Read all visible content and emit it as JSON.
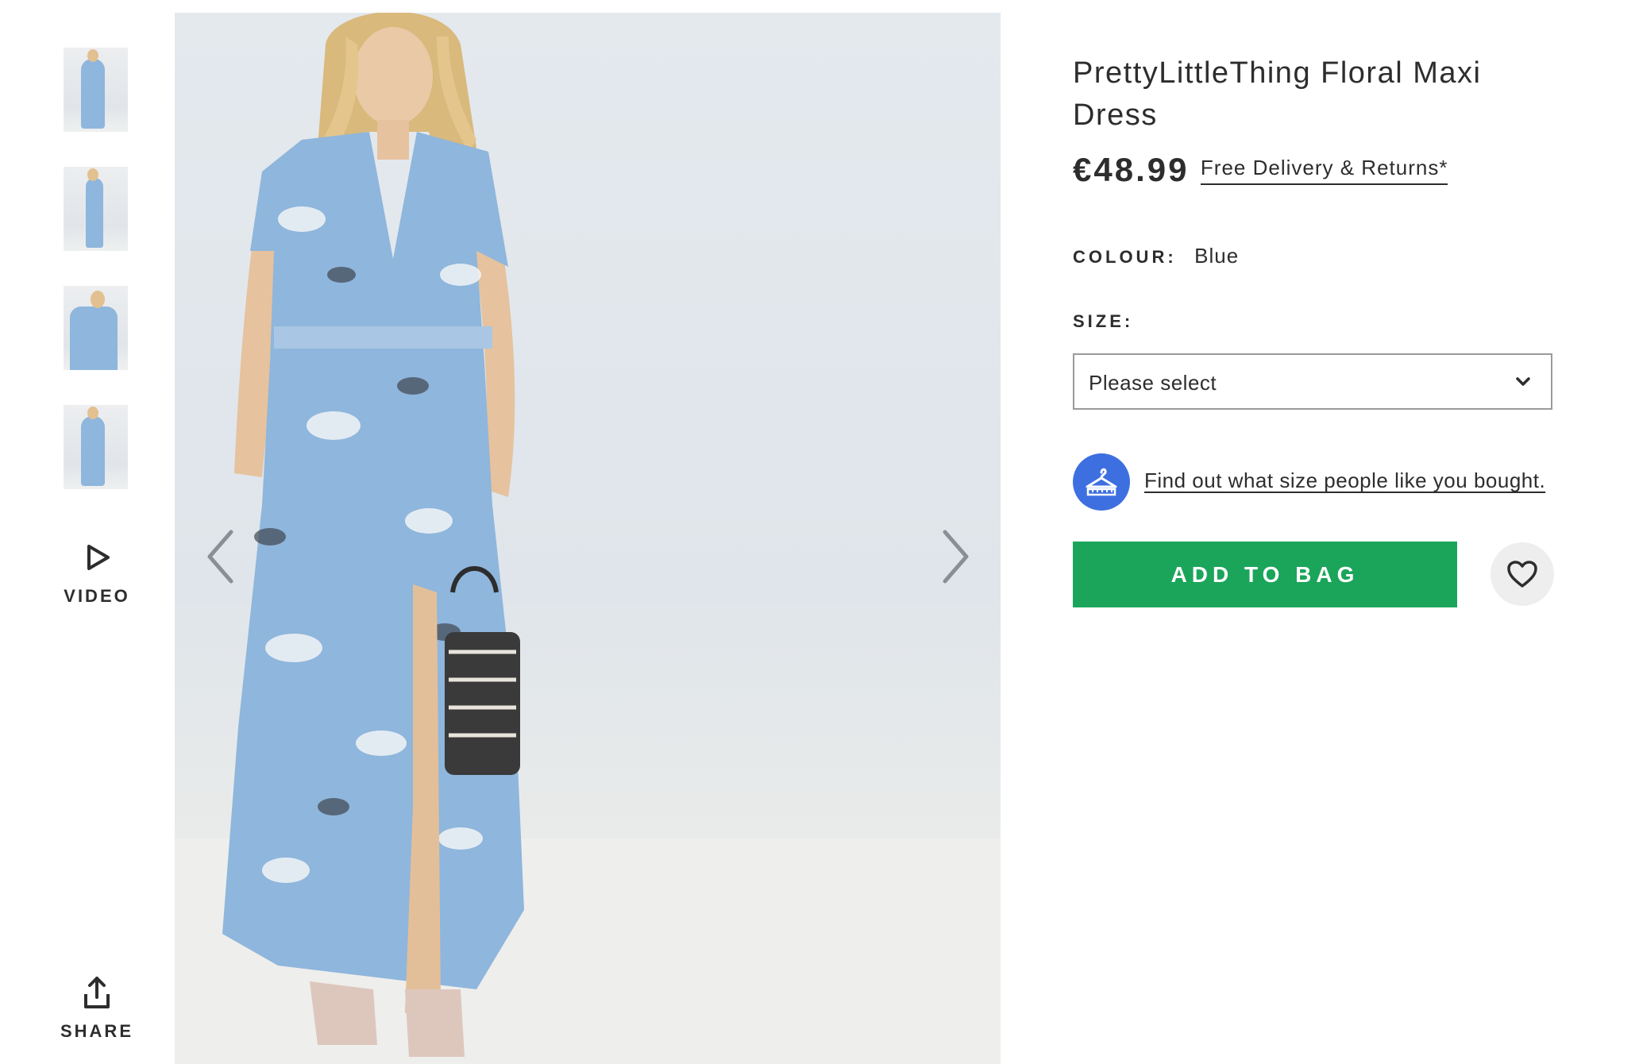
{
  "gallery": {
    "thumbnails": [
      {
        "alt": "thumbnail-1"
      },
      {
        "alt": "thumbnail-2"
      },
      {
        "alt": "thumbnail-3"
      },
      {
        "alt": "thumbnail-4"
      }
    ],
    "video_label": "VIDEO",
    "share_label": "SHARE",
    "icons": {
      "play": "play-icon",
      "share": "share-icon",
      "prev": "chevron-left-icon",
      "next": "chevron-right-icon"
    }
  },
  "product": {
    "title": "PrettyLittleThing Floral Maxi Dress",
    "price": "€48.99",
    "delivery_link": "Free Delivery & Returns*",
    "colour_label": "COLOUR:",
    "colour_value": "Blue",
    "size_label": "SIZE:",
    "size_select_value": "Please select",
    "fit_link": "Find out what size people like you bought.",
    "add_to_bag_label": "ADD TO BAG",
    "icons": {
      "fit": "hanger-icon",
      "save": "heart-icon",
      "dropdown": "chevron-down-icon"
    }
  },
  "colors": {
    "accent_green": "#1aa55a",
    "fit_blue": "#3d6fe0",
    "text": "#2d2d2d",
    "dress_blue": "#8fb6dc"
  }
}
